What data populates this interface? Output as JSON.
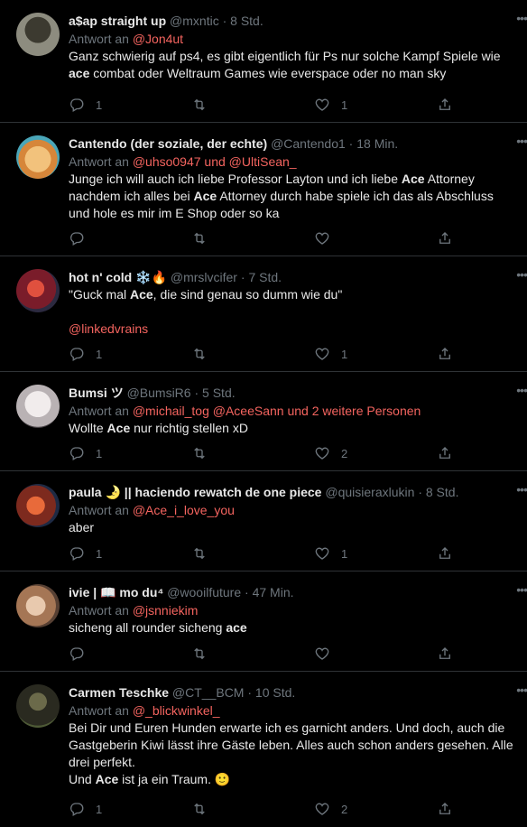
{
  "tweets": [
    {
      "name": "a$ap straight up",
      "handle": "@mxntic",
      "time": "8 Std.",
      "reply_prefix": "Antwort an",
      "reply_to": "@Jon4ut",
      "text_parts": [
        "Ganz schwierig auf ps4, es gibt eigentlich für Ps nur solche Kampf Spiele wie ",
        "ace",
        " combat oder Weltraum Games wie everspace oder no man sky"
      ],
      "replies": "1",
      "retweets": "",
      "likes": "1",
      "avatar_color": "#6b6a5e"
    },
    {
      "name": "Cantendo (der soziale, der echte)",
      "handle": "@Cantendo1",
      "time": "18 Min.",
      "reply_prefix": "Antwort an",
      "reply_to": "@uhso0947 und @UltiSean_",
      "text_parts": [
        "Junge ich will auch ich liebe Professor Layton und ich liebe ",
        "Ace",
        " Attorney nachdem ich alles bei ",
        "Ace",
        " Attorney durch habe spiele ich das als Abschluss und hole es mir im E Shop oder so ka"
      ],
      "replies": "",
      "retweets": "",
      "likes": "",
      "avatar_color": "#e0a35a"
    },
    {
      "name": "hot n' cold",
      "name_emoji": "❄️🔥",
      "handle": "@mrslvcifer",
      "time": "7 Std.",
      "reply_prefix": "",
      "reply_to": "",
      "text_parts": [
        "\"Guck mal ",
        "Ace",
        ", die sind genau so dumm wie du\""
      ],
      "extra_mention": "@linkedvrains",
      "replies": "1",
      "retweets": "",
      "likes": "1",
      "avatar_color": "#8a2a34"
    },
    {
      "name": "Bumsi",
      "name_emoji": "ツ",
      "handle": "@BumsiR6",
      "time": "5 Std.",
      "reply_prefix": "Antwort an",
      "reply_to": "@michail_tog @AceeSann und 2 weitere Personen",
      "text_parts": [
        "Wollte ",
        "Ace",
        " nur richtig stellen xD"
      ],
      "replies": "1",
      "retweets": "",
      "likes": "2",
      "avatar_color": "#d8d4d6"
    },
    {
      "name": "paula",
      "name_emoji": "🌛",
      "name_suffix": " || haciendo rewatch de one piece",
      "handle": "@quisieraxlukin",
      "time": "8 Std.",
      "reply_prefix": "Antwort an",
      "reply_to": "@Ace_i_love_you",
      "text_parts": [
        "aber"
      ],
      "replies": "1",
      "retweets": "",
      "likes": "1",
      "avatar_color": "#b04a2a"
    },
    {
      "name": "ivie |",
      "name_emoji": "📖",
      "name_suffix": " mo du⁴",
      "handle": "@wooilfuture",
      "time": "47 Min.",
      "reply_prefix": "Antwort an",
      "reply_to": "@jsnniekim",
      "text_parts": [
        "sicheng all rounder sicheng ",
        "ace"
      ],
      "replies": "",
      "retweets": "",
      "likes": "",
      "avatar_color": "#c9a58a"
    },
    {
      "name": "Carmen Teschke",
      "handle": "@CT__BCM",
      "time": "10 Std.",
      "reply_prefix": "Antwort an",
      "reply_to": "@_blickwinkel_",
      "text_parts": [
        "Bei Dir und Euren Hunden erwarte ich es garnicht anders. Und doch, auch die Gastgeberin Kiwi lässt ihre Gäste leben. Alles auch schon anders gesehen. Alle drei perfekt.\nUnd ",
        "Ace",
        " ist ja ein Traum. 🙂"
      ],
      "replies": "1",
      "retweets": "",
      "likes": "2",
      "avatar_color": "#3a3a2e"
    }
  ],
  "colors": {
    "background": "#000000",
    "divider": "#2f3336",
    "mention": "#f4645f",
    "muted": "#6e767d"
  },
  "icons": [
    "reply-icon",
    "retweet-icon",
    "like-icon",
    "share-icon",
    "more-icon"
  ]
}
